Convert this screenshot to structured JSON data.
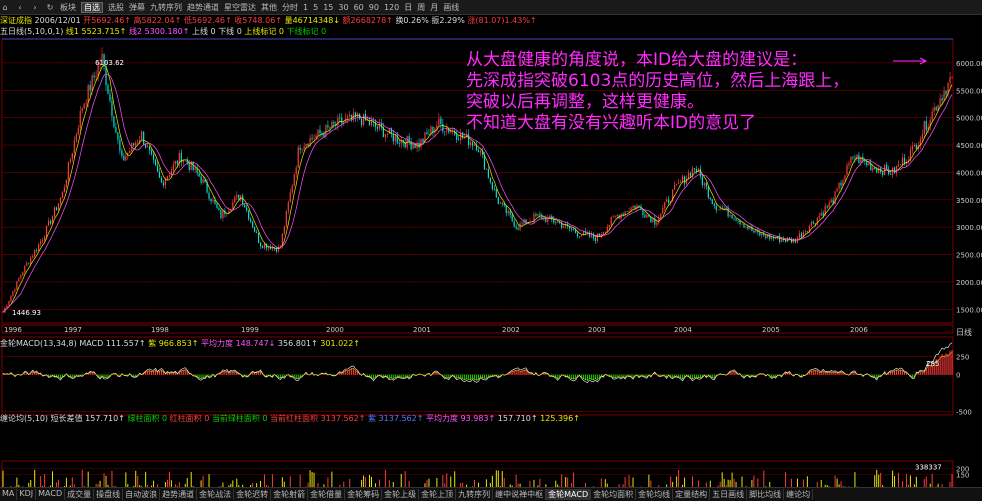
{
  "toolbar": {
    "items": [
      "板块",
      "自选",
      "选股",
      "弹幕",
      "九转序列",
      "趋势通道",
      "星空雷达",
      "其他",
      "分时",
      "1",
      "5",
      "15",
      "30",
      "60",
      "90",
      "120",
      "日",
      "周",
      "月",
      "画线"
    ],
    "selected": "自选"
  },
  "info": {
    "name": "深证成指",
    "date": "2006/12/01",
    "open": "开5692.46↑",
    "high": "高5822.04↑",
    "low": "低5692.46↑",
    "close": "收5748.06↑",
    "volume": "量46714348↓",
    "amount": "额2668278↑",
    "turnover": "换0.26%",
    "amplitude": "振2.29%",
    "change": "涨(81.07)1.43%↑"
  },
  "indicator_line": {
    "name": "五日线(5,10,0,1)",
    "line1": "线1 5523.715↑",
    "line2": "线2 5300.180↑",
    "up": "上线 0",
    "down": "下线 0",
    "upmark": "上线标记 0",
    "downmark": "下线标记 0"
  },
  "peak_label": "6103.62",
  "low_label": "1446.93",
  "ytick_top_label": "6103.62",
  "annotation": [
    "从大盘健康的角度说，本ID给大盘的建议是：",
    "先深成指突破6103点的历史高位，然后上海跟上，",
    "突破以后再调整，这样更健康。",
    "不知道大盘有没有兴趣听本ID的意见了"
  ],
  "macd_info": {
    "name": "金轮MACD(13,34,8)",
    "macd": "MACD 111.557↑",
    "c1": "紫 966.853↑",
    "c2": "平均力度 148.747↓",
    "c3": "356.801↑",
    "c4": "301.022↑",
    "last_label": "285"
  },
  "vol_info": {
    "name": "缠论均(5,10)",
    "a": "短长差值 157.710↑",
    "b": "绿柱面积 0",
    "c": "红柱面积 0",
    "d": "当前绿柱面积 0",
    "e": "当前红柱面积 3137.562↑",
    "f": "紫 3137.562↑",
    "g": "平均力度 93.983↑",
    "h": "157.710↑",
    "i": "125.396↑",
    "last_label": "338337"
  },
  "right_panel_label": "日线",
  "bottom_tabs": [
    "MA",
    "KDJ",
    "MACD",
    "成交量",
    "操盘线",
    "自动波浪",
    "趋势通道",
    "金轮战法",
    "金轮迟转",
    "金轮射箭",
    "金轮借量",
    "金轮筹码",
    "金轮上级",
    "金轮上顶",
    "九转序列",
    "缠中说禅中枢",
    "金轮MACD",
    "金轮均面积",
    "金轮均线",
    "定量结构",
    "五日画线",
    "脚比均线",
    "缠论均"
  ],
  "bottom_active": "金轮MACD",
  "colors": {
    "up": "#ff3b3b",
    "down": "#00e0e0",
    "ma5": "#e8e800",
    "ma10": "#ff55ff",
    "grid": "#8b0000",
    "axis": "#cc0000",
    "annot": "#ff2bff"
  },
  "chart_data": [
    {
      "type": "line",
      "title": "深证成指",
      "x": [
        "1996",
        "1997",
        "1998",
        "1999",
        "2000",
        "2001",
        "2002",
        "2003",
        "2004",
        "2005",
        "2006"
      ],
      "y_ticks": [
        1500,
        2000,
        2500,
        3000,
        3500,
        4000,
        4500,
        5000,
        5500,
        6000
      ],
      "ylim": [
        1250,
        6400
      ],
      "series": [
        {
          "values": [
            1446.93,
            2200,
            2800,
            3600,
            5200,
            6103.62,
            4200,
            4700,
            3800,
            4300,
            3900,
            3200,
            3600,
            2700,
            2600,
            4500,
            4700,
            4900,
            5000,
            4800,
            4600,
            4500,
            4900,
            4700,
            4500,
            3500,
            3000,
            3200,
            3100,
            2900,
            2800,
            3200,
            3400,
            3100,
            3700,
            4100,
            3400,
            3200,
            2900,
            2800,
            2750,
            3100,
            3500,
            4300,
            4100,
            4000,
            4400,
            5100,
            5748.06
          ]
        }
      ]
    },
    {
      "type": "bar",
      "title": "金轮MACD(13,34,8)",
      "y_ticks": [
        -500,
        0,
        250
      ],
      "ylim": [
        -550,
        350
      ]
    },
    {
      "type": "bar",
      "title": "缠论均(5,10)",
      "y_ticks": [
        -150,
        0,
        150,
        200
      ],
      "ylim": [
        -200,
        230
      ]
    }
  ]
}
